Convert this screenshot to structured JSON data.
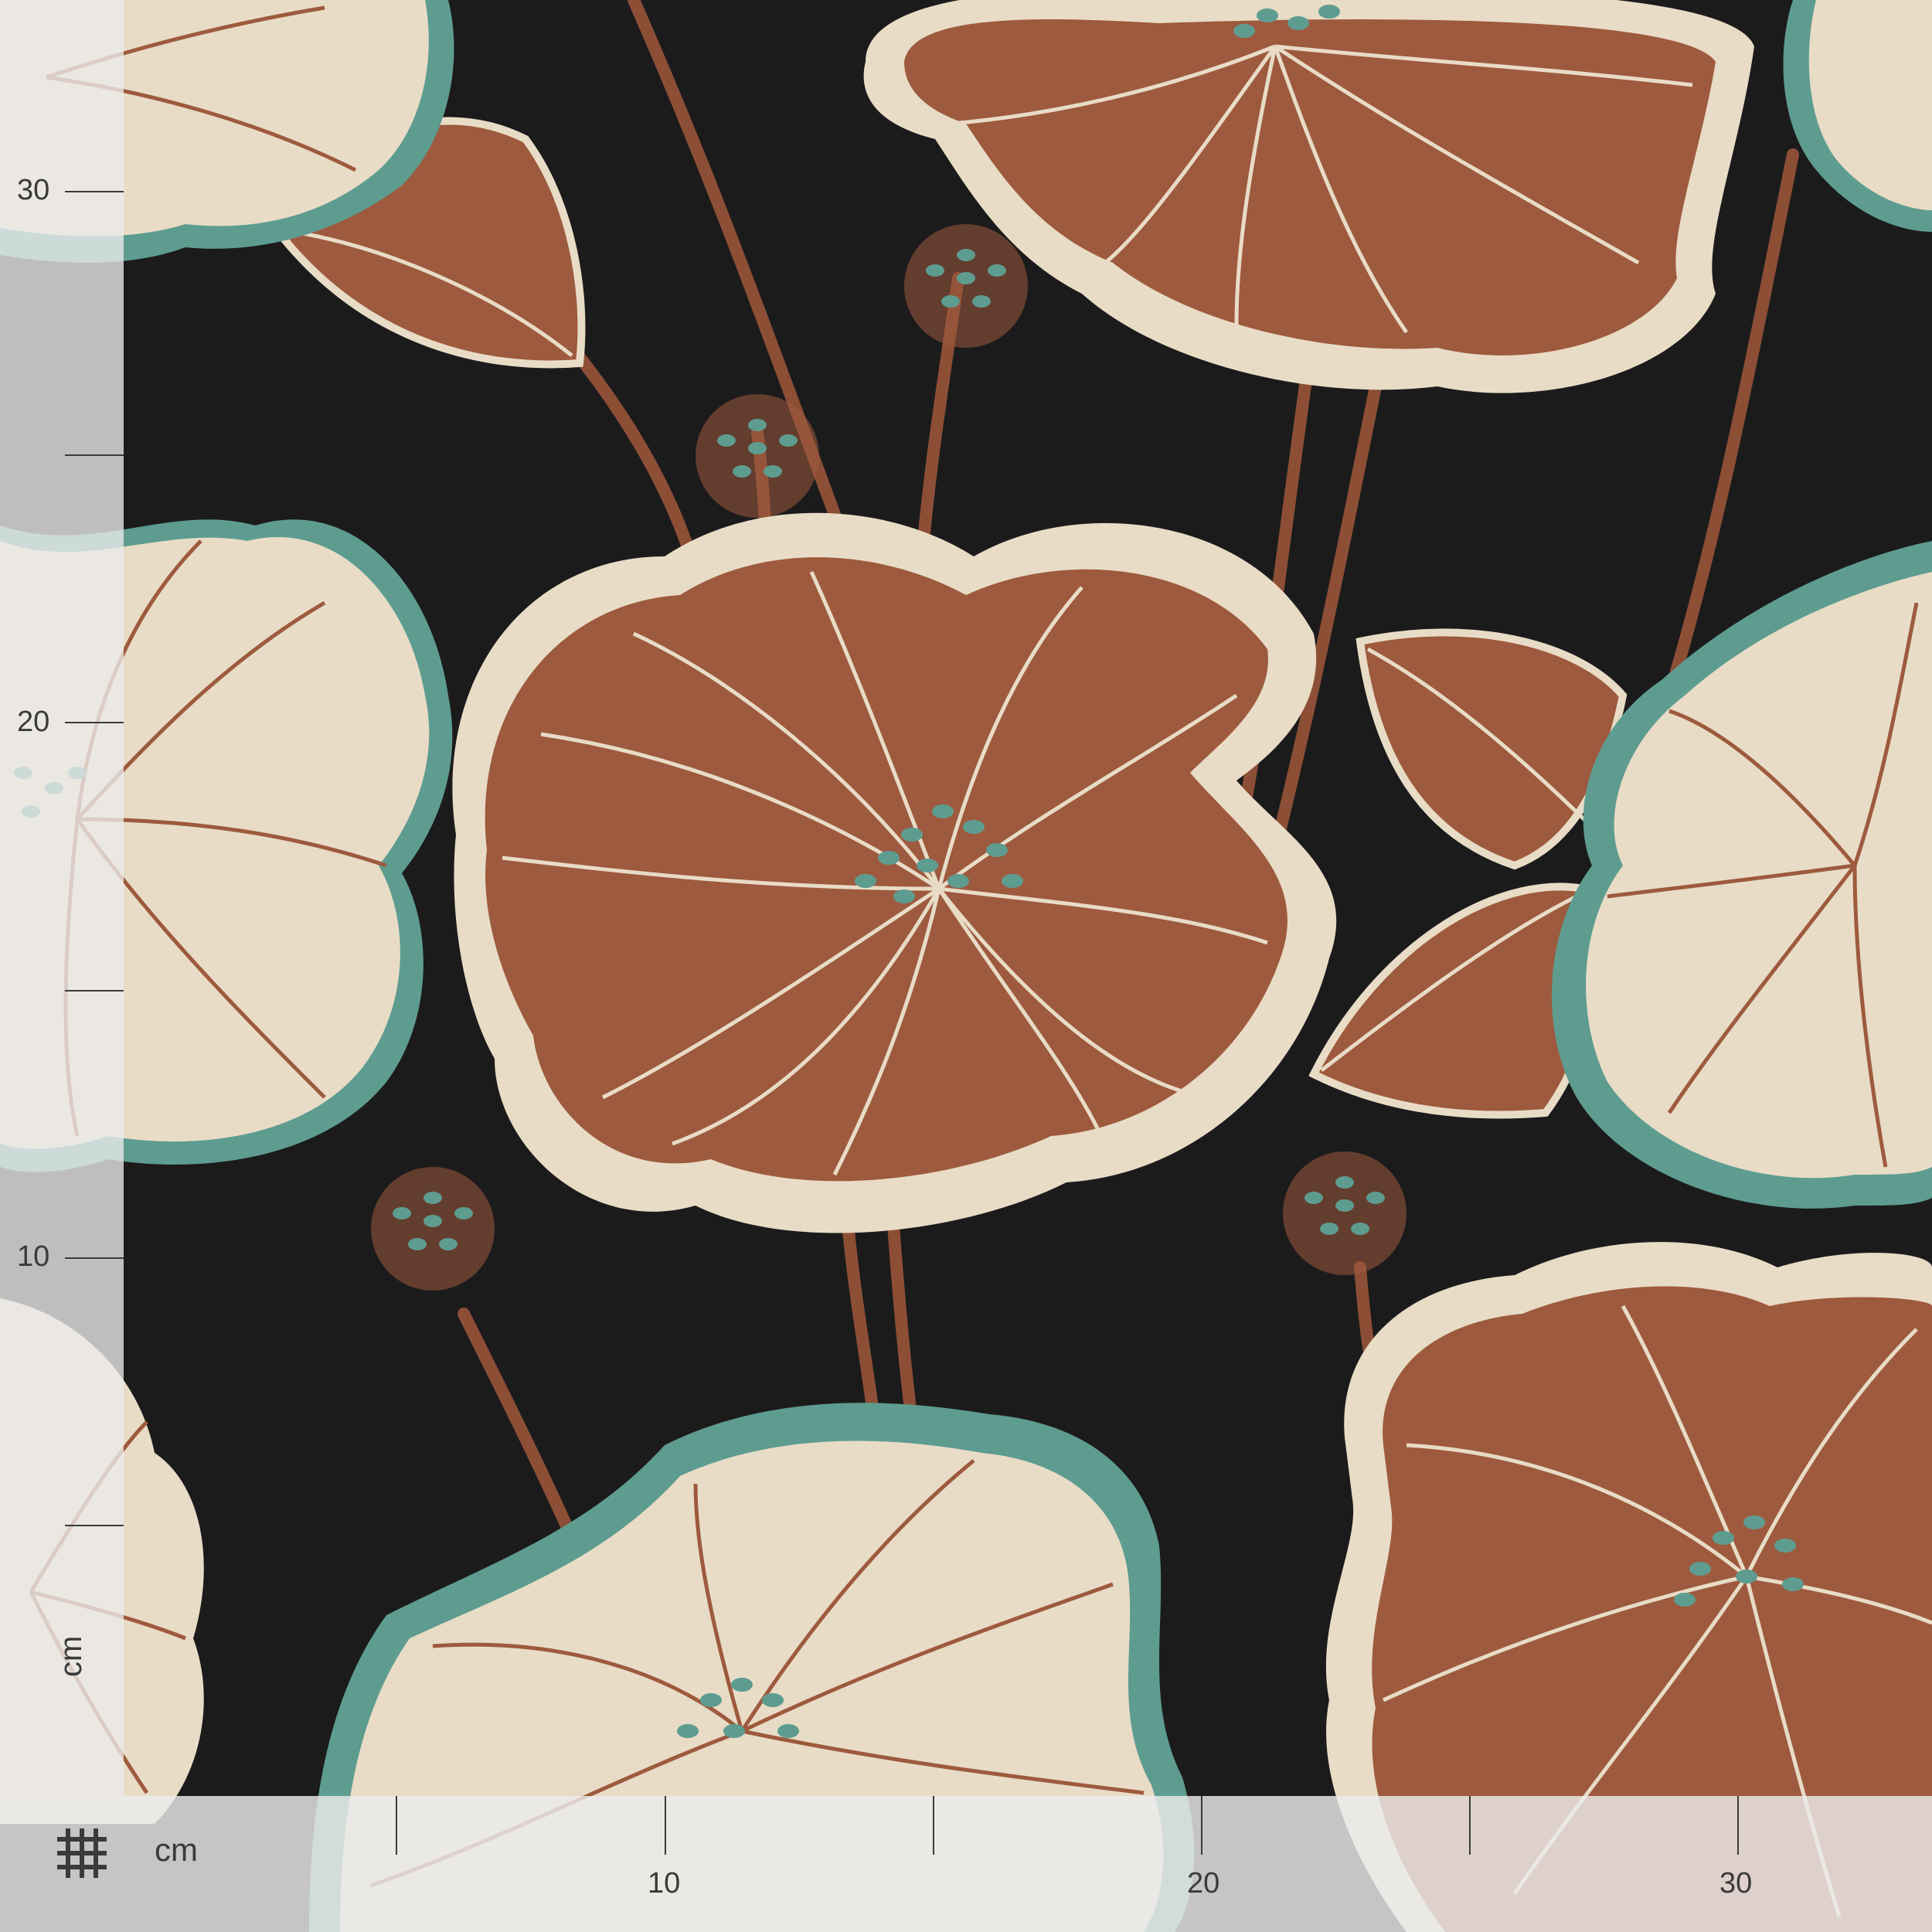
{
  "image": {
    "subject": "fabric swatch",
    "pattern": "floral",
    "colors": {
      "background": "#1c1b1c",
      "petal_rust": "#9e5a3e",
      "petal_cream": "#e8dcc6",
      "outline_teal": "#5e9c90",
      "stem": "#8c4f36"
    }
  },
  "ruler": {
    "unit": "cm",
    "left_labels": [
      "30",
      "20",
      "10"
    ],
    "bottom_labels": [
      "10",
      "20",
      "30"
    ]
  }
}
